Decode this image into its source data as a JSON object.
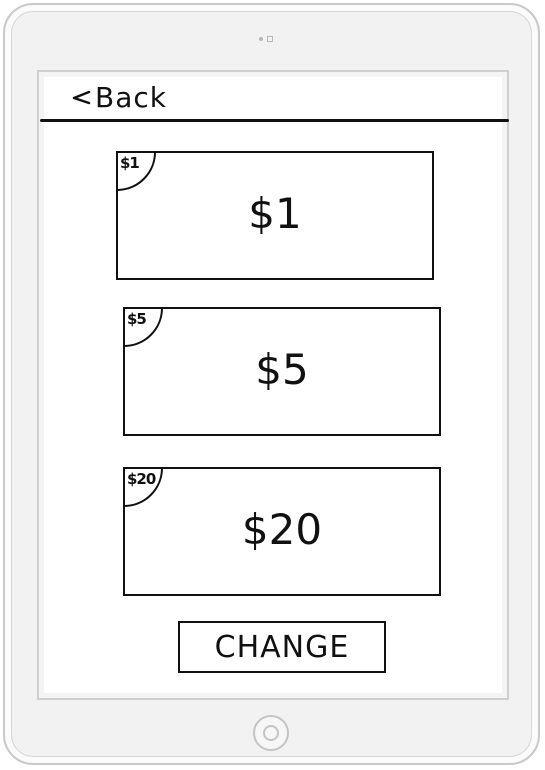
{
  "nav": {
    "back_label": "Back",
    "back_icon": "chevron-left-icon"
  },
  "bills": [
    {
      "corner_label": "$1",
      "value_label": "$1"
    },
    {
      "corner_label": "$5",
      "value_label": "$5"
    },
    {
      "corner_label": "$20",
      "value_label": "$20"
    }
  ],
  "actions": {
    "change_label": "CHANGE"
  },
  "device": {
    "home_button_icon": "home-button-icon",
    "camera_icon": "camera-icon"
  },
  "colors": {
    "ink": "#111111",
    "device_frame": "#c9c9c9",
    "screen_background": "#ffffff"
  }
}
